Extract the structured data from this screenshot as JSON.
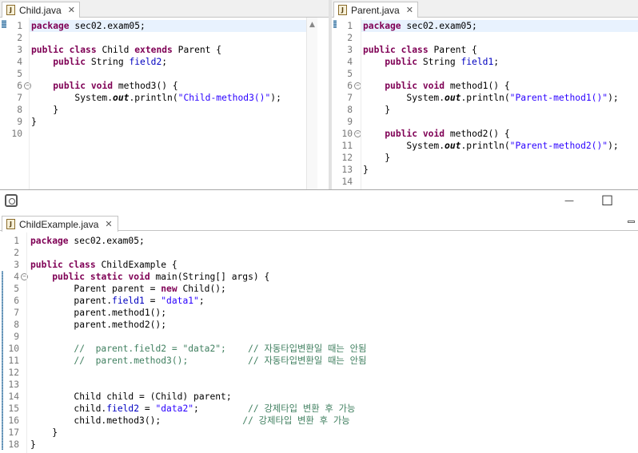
{
  "left_editor": {
    "tab_label": "Child.java",
    "icon_letter": "J",
    "line_numbers": [
      "1",
      "2",
      "3",
      "4",
      "5",
      "6",
      "7",
      "8",
      "9",
      "10"
    ],
    "lines": [
      [
        {
          "t": "package",
          "c": "kw"
        },
        {
          "t": " sec02.exam05;"
        }
      ],
      [
        {
          "t": ""
        }
      ],
      [
        {
          "t": "public",
          "c": "kw"
        },
        {
          "t": " "
        },
        {
          "t": "class",
          "c": "kw"
        },
        {
          "t": " Child "
        },
        {
          "t": "extends",
          "c": "kw"
        },
        {
          "t": " Parent {"
        }
      ],
      [
        {
          "t": "    "
        },
        {
          "t": "public",
          "c": "kw"
        },
        {
          "t": " String "
        },
        {
          "t": "field2",
          "c": "fld"
        },
        {
          "t": ";"
        }
      ],
      [
        {
          "t": ""
        }
      ],
      [
        {
          "t": "    "
        },
        {
          "t": "public",
          "c": "kw"
        },
        {
          "t": " "
        },
        {
          "t": "void",
          "c": "kw"
        },
        {
          "t": " method3() {"
        }
      ],
      [
        {
          "t": "        System."
        },
        {
          "t": "out",
          "c": "sta"
        },
        {
          "t": ".println("
        },
        {
          "t": "\"Child-method3()\"",
          "c": "str"
        },
        {
          "t": ");"
        }
      ],
      [
        {
          "t": "    }"
        }
      ],
      [
        {
          "t": "}"
        }
      ],
      [
        {
          "t": ""
        }
      ]
    ]
  },
  "right_editor": {
    "tab_label": "Parent.java",
    "icon_letter": "J",
    "line_numbers": [
      "1",
      "2",
      "3",
      "4",
      "5",
      "6",
      "7",
      "8",
      "9",
      "10",
      "11",
      "12",
      "13",
      "14"
    ],
    "lines": [
      [
        {
          "t": "package",
          "c": "kw"
        },
        {
          "t": " sec02.exam05;"
        }
      ],
      [
        {
          "t": ""
        }
      ],
      [
        {
          "t": "public",
          "c": "kw"
        },
        {
          "t": " "
        },
        {
          "t": "class",
          "c": "kw"
        },
        {
          "t": " Parent {"
        }
      ],
      [
        {
          "t": "    "
        },
        {
          "t": "public",
          "c": "kw"
        },
        {
          "t": " String "
        },
        {
          "t": "field1",
          "c": "fld"
        },
        {
          "t": ";"
        }
      ],
      [
        {
          "t": ""
        }
      ],
      [
        {
          "t": "    "
        },
        {
          "t": "public",
          "c": "kw"
        },
        {
          "t": " "
        },
        {
          "t": "void",
          "c": "kw"
        },
        {
          "t": " method1() {"
        }
      ],
      [
        {
          "t": "        System."
        },
        {
          "t": "out",
          "c": "sta"
        },
        {
          "t": ".println("
        },
        {
          "t": "\"Parent-method1()\"",
          "c": "str"
        },
        {
          "t": ");"
        }
      ],
      [
        {
          "t": "    }"
        }
      ],
      [
        {
          "t": ""
        }
      ],
      [
        {
          "t": "    "
        },
        {
          "t": "public",
          "c": "kw"
        },
        {
          "t": " "
        },
        {
          "t": "void",
          "c": "kw"
        },
        {
          "t": " method2() {"
        }
      ],
      [
        {
          "t": "        System."
        },
        {
          "t": "out",
          "c": "sta"
        },
        {
          "t": ".println("
        },
        {
          "t": "\"Parent-method2()\"",
          "c": "str"
        },
        {
          "t": ");"
        }
      ],
      [
        {
          "t": "    }"
        }
      ],
      [
        {
          "t": "}"
        }
      ],
      [
        {
          "t": ""
        }
      ]
    ]
  },
  "bottom_editor": {
    "tab_label": "ChildExample.java",
    "icon_letter": "J",
    "line_numbers": [
      "1",
      "2",
      "3",
      "4",
      "5",
      "6",
      "7",
      "8",
      "9",
      "10",
      "11",
      "12",
      "13",
      "14",
      "15",
      "16",
      "17",
      "18"
    ],
    "lines": [
      [
        {
          "t": "package",
          "c": "kw"
        },
        {
          "t": " sec02.exam05;"
        }
      ],
      [
        {
          "t": ""
        }
      ],
      [
        {
          "t": "public",
          "c": "kw"
        },
        {
          "t": " "
        },
        {
          "t": "class",
          "c": "kw"
        },
        {
          "t": " ChildExample {"
        }
      ],
      [
        {
          "t": "    "
        },
        {
          "t": "public",
          "c": "kw"
        },
        {
          "t": " "
        },
        {
          "t": "static",
          "c": "kw"
        },
        {
          "t": " "
        },
        {
          "t": "void",
          "c": "kw"
        },
        {
          "t": " main(String[] args) {"
        }
      ],
      [
        {
          "t": "        Parent parent = "
        },
        {
          "t": "new",
          "c": "kw"
        },
        {
          "t": " Child();"
        }
      ],
      [
        {
          "t": "        parent."
        },
        {
          "t": "field1",
          "c": "fld"
        },
        {
          "t": " = "
        },
        {
          "t": "\"data1\"",
          "c": "str"
        },
        {
          "t": ";"
        }
      ],
      [
        {
          "t": "        parent.method1();"
        }
      ],
      [
        {
          "t": "        parent.method2();"
        }
      ],
      [
        {
          "t": ""
        }
      ],
      [
        {
          "t": "        "
        },
        {
          "t": "//  parent.field2 = \"data2\";    // 자동타입변환일 때는 안됨",
          "c": "cmt"
        }
      ],
      [
        {
          "t": "        "
        },
        {
          "t": "//  parent.method3();           // 자동타입변환일 때는 안됨",
          "c": "cmt"
        }
      ],
      [
        {
          "t": ""
        }
      ],
      [
        {
          "t": ""
        }
      ],
      [
        {
          "t": "        Child child = (Child) parent;"
        }
      ],
      [
        {
          "t": "        child."
        },
        {
          "t": "field2",
          "c": "fld"
        },
        {
          "t": " = "
        },
        {
          "t": "\"data2\"",
          "c": "str"
        },
        {
          "t": ";         "
        },
        {
          "t": "// 강제타입 변환 후 가능",
          "c": "cmt"
        }
      ],
      [
        {
          "t": "        child.method3();               "
        },
        {
          "t": "// 강제타입 변환 후 가능",
          "c": "cmt"
        }
      ],
      [
        {
          "t": "    }"
        }
      ],
      [
        {
          "t": "}"
        }
      ]
    ]
  },
  "fold_markers": {
    "collapse_symbol": "⊖"
  },
  "window_controls": {
    "minimize": "—",
    "maximize": "□"
  }
}
